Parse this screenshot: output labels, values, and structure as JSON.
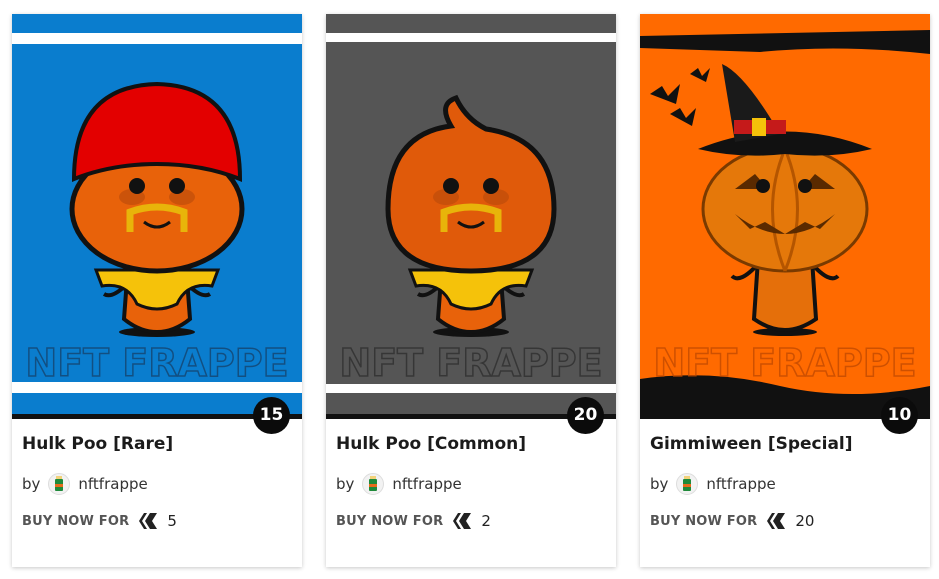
{
  "cards": [
    {
      "title": "Hulk Poo [Rare]",
      "by_label": "by",
      "author": "nftfrappe",
      "count": "15",
      "buy_label": "BUY NOW FOR",
      "price": "5",
      "watermark": "NFT FRAPPE",
      "colors": {
        "background": "#0a7dce",
        "accent": "#e60000"
      }
    },
    {
      "title": "Hulk Poo [Common]",
      "by_label": "by",
      "author": "nftfrappe",
      "count": "20",
      "buy_label": "BUY NOW FOR",
      "price": "2",
      "watermark": "NFT FRAPPE",
      "colors": {
        "background": "#555555",
        "accent": "#e0520a"
      }
    },
    {
      "title": "Gimmiween [Special]",
      "by_label": "by",
      "author": "nftfrappe",
      "count": "10",
      "buy_label": "BUY NOW FOR",
      "price": "20",
      "watermark": "NFT FRAPPE",
      "colors": {
        "background": "#ff6a00",
        "accent": "#e56f0a"
      }
    }
  ],
  "icons": {
    "currency": "hive-icon",
    "avatar": "frappe-cup-avatar"
  }
}
